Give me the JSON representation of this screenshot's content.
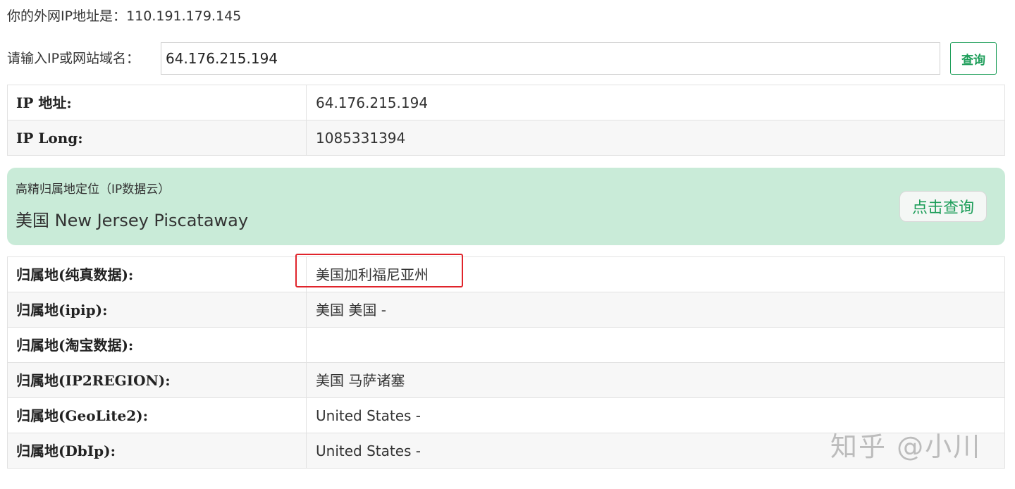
{
  "header": {
    "my_ip_label": "你的外网IP地址是：",
    "my_ip_value": "110.191.179.145"
  },
  "query": {
    "label": "请输入IP或网站域名：",
    "input_value": "64.176.215.194",
    "button_label": "查询"
  },
  "basic_info": [
    {
      "label": "IP 地址:",
      "value": "64.176.215.194"
    },
    {
      "label": "IP Long:",
      "value": "1085331394"
    }
  ],
  "geo_panel": {
    "title": "高精归属地定位（IP数据云）",
    "value": "美国 New Jersey Piscataway",
    "button_label": "点击查询"
  },
  "location_info": [
    {
      "label": "归属地(纯真数据):",
      "value": "美国加利福尼亚州"
    },
    {
      "label": "归属地(ipip):",
      "value": "美国 美国 -"
    },
    {
      "label": "归属地(淘宝数据):",
      "value": ""
    },
    {
      "label": "归属地(IP2REGION):",
      "value": "美国 马萨诸塞"
    },
    {
      "label": "归属地(GeoLite2):",
      "value": "United States -"
    },
    {
      "label": "归属地(DbIp):",
      "value": "United States -"
    }
  ],
  "watermark": "知乎 @小川",
  "colors": {
    "accent_green": "#1e9e5a",
    "panel_green": "#c9ebd8",
    "highlight_red": "#e0242b"
  }
}
